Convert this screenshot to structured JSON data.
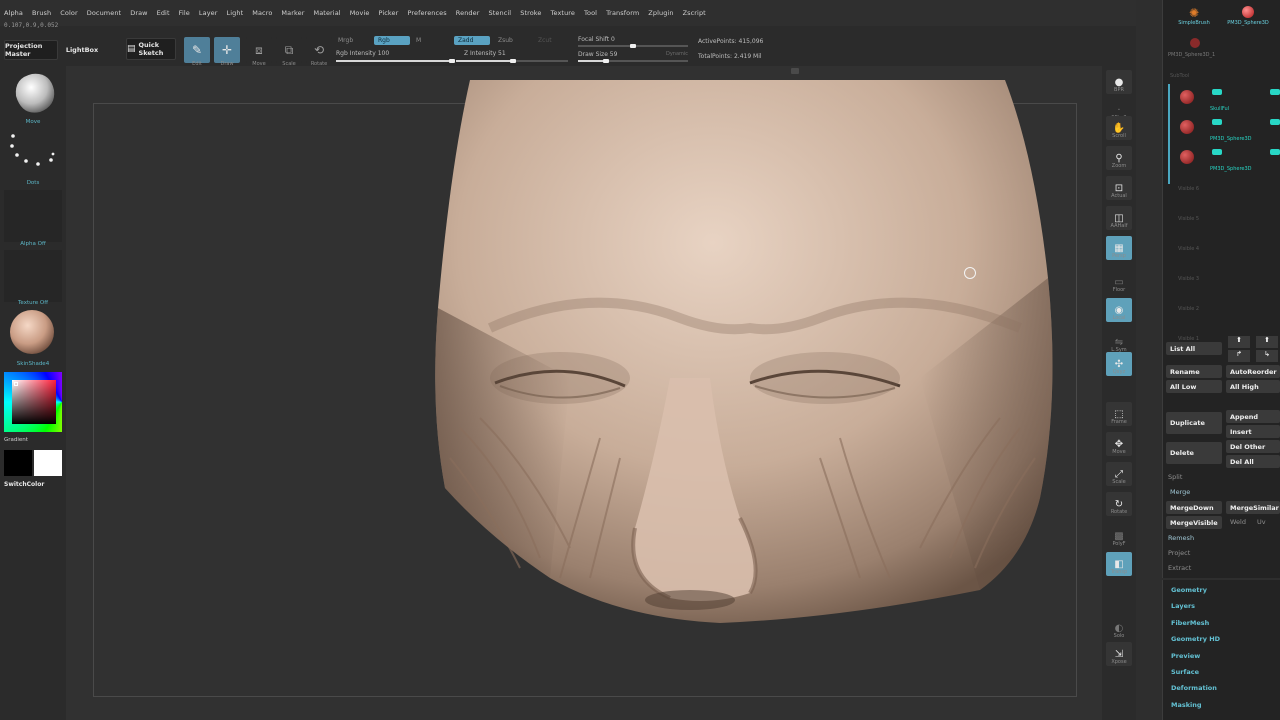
{
  "menu": [
    "Alpha",
    "Brush",
    "Color",
    "Document",
    "Draw",
    "Edit",
    "File",
    "Layer",
    "Light",
    "Macro",
    "Marker",
    "Material",
    "Movie",
    "Picker",
    "Preferences",
    "Render",
    "Stencil",
    "Stroke",
    "Texture",
    "Tool",
    "Transform",
    "Zplugin",
    "Zscript"
  ],
  "coords": "0.107,0.9,0.052",
  "toolbar": {
    "projection_master": "Projection Master",
    "lightbox": "LightBox",
    "quick_sketch": "Quick Sketch",
    "edit": "Edit",
    "draw": "Draw",
    "move": "Move",
    "scale": "Scale",
    "rotate": "Rotate",
    "mrgb": "Mrgb",
    "rgb": "Rgb",
    "m": "M",
    "zadd": "Zadd",
    "zsub": "Zsub",
    "zcut": "Zcut",
    "rgb_intensity": "Rgb Intensity 100",
    "z_intensity": "Z Intensity 51",
    "focal_shift": "Focal Shift 0",
    "draw_size": "Draw Size 59",
    "dynamic": "Dynamic",
    "active_points": "ActivePoints: 415,096",
    "total_points": "TotalPoints: 2.419 Mil",
    "rgb_intensity_value": 1.0,
    "z_intensity_value": 0.51,
    "draw_size_value": 0.25
  },
  "left": {
    "brush_label": "Move",
    "stroke_label": "Dots",
    "alpha_label": "Alpha Off",
    "texture_label": "Texture Off",
    "material_label": "SkinShade4",
    "gradient_label": "Gradient",
    "switch_color": "SwitchColor"
  },
  "dock": [
    {
      "label": "BPR",
      "icon": "render-sphere-icon"
    },
    {
      "label": "SPix 3",
      "icon": "spix-icon"
    },
    {
      "label": "Scroll",
      "icon": "hand-icon"
    },
    {
      "label": "Zoom",
      "icon": "zoom-icon"
    },
    {
      "label": "Actual",
      "icon": "actual-size-icon"
    },
    {
      "label": "AAHalf",
      "icon": "aahalf-icon"
    },
    {
      "label": "Persp",
      "icon": "perspective-icon"
    },
    {
      "label": "Floor",
      "icon": "floor-icon"
    },
    {
      "label": "Local",
      "icon": "local-icon"
    },
    {
      "label": "L.Sym",
      "icon": "lsym-icon"
    },
    {
      "label": "Qxyz",
      "icon": "xyz-icon"
    },
    {
      "label": "Frame",
      "icon": "frame-icon"
    },
    {
      "label": "Move",
      "icon": "move-icon"
    },
    {
      "label": "Scale",
      "icon": "scale-icon"
    },
    {
      "label": "Rotate",
      "icon": "rotate-icon"
    },
    {
      "label": "PolyF",
      "icon": "polyframe-icon"
    },
    {
      "label": "Transp",
      "icon": "transparency-icon"
    },
    {
      "label": "Solo",
      "icon": "solo-icon"
    },
    {
      "label": "Xpose",
      "icon": "xpose-icon"
    }
  ],
  "tray": {
    "simple_brush": "SimpleBrush",
    "pm3d_sphere": "PM3D_Sphere3D",
    "pm3d_sphere2": "PM3D_Sphere3D_1"
  },
  "subtool": {
    "title": "SubTool",
    "items": [
      "SkullFul",
      "PM3D_Sphere3D",
      "PM3D_Sphere3D"
    ],
    "empty_rows": [
      "Visible 6",
      "Visible 5",
      "Visible 4",
      "Visible 3",
      "Visible 2",
      "Visible 1"
    ]
  },
  "subtool_buttons": {
    "list_all": "List All",
    "rename": "Rename",
    "auto_reorder": "AutoReorder",
    "all_low": "All Low",
    "all_high": "All High",
    "duplicate": "Duplicate",
    "append": "Append",
    "insert": "Insert",
    "delete": "Delete",
    "del_other": "Del Other",
    "del_all": "Del All",
    "split": "Split",
    "merge": "Merge",
    "merge_down": "MergeDown",
    "merge_similar": "MergeSimilar",
    "merge_visible": "MergeVisible",
    "weld": "Weld",
    "uv": "Uv",
    "remesh": "Remesh",
    "project": "Project",
    "extract": "Extract"
  },
  "tool_menus": [
    "Geometry",
    "Layers",
    "FiberMesh",
    "Geometry HD",
    "Preview",
    "Surface",
    "Deformation",
    "Masking"
  ]
}
